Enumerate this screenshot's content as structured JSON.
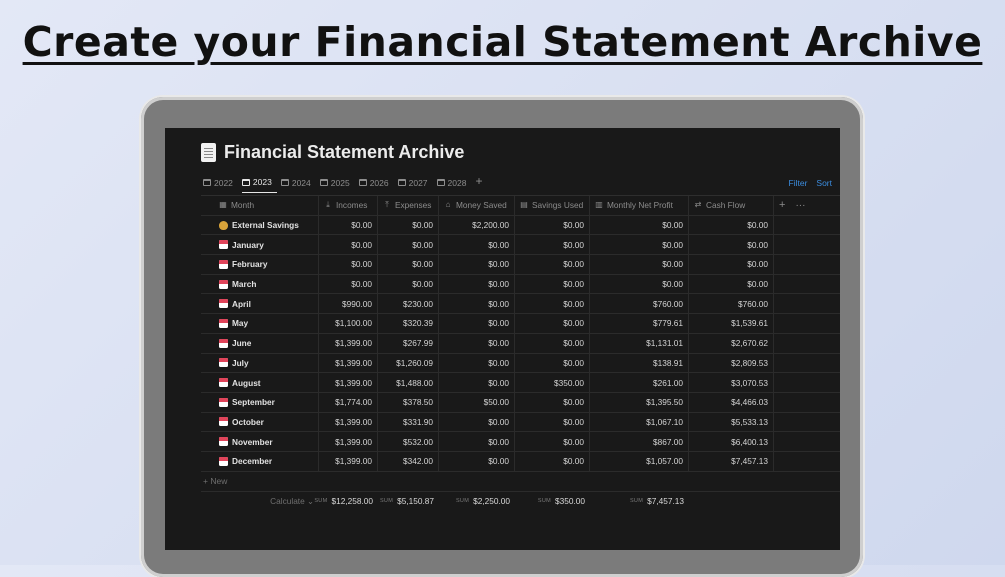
{
  "headline": "Create your Financial Statement Archive",
  "page": {
    "title": "Financial Statement Archive"
  },
  "tabs": [
    {
      "label": "2022",
      "active": false
    },
    {
      "label": "2023",
      "active": true
    },
    {
      "label": "2024",
      "active": false
    },
    {
      "label": "2025",
      "active": false
    },
    {
      "label": "2026",
      "active": false
    },
    {
      "label": "2027",
      "active": false
    },
    {
      "label": "2028",
      "active": false
    }
  ],
  "toolbar": {
    "filter": "Filter",
    "sort": "Sort"
  },
  "columns": [
    "Month",
    "Incomes",
    "Expenses",
    "Money Saved",
    "Savings Used",
    "Monthly Net Profit",
    "Cash Flow"
  ],
  "rows": [
    {
      "month": "External Savings",
      "icon": "money-bag-icon",
      "incomes": "$0.00",
      "expenses": "$0.00",
      "saved": "$2,200.00",
      "used": "$0.00",
      "net": "$0.00",
      "cash": "$0.00"
    },
    {
      "month": "January",
      "icon": "calendar-icon",
      "incomes": "$0.00",
      "expenses": "$0.00",
      "saved": "$0.00",
      "used": "$0.00",
      "net": "$0.00",
      "cash": "$0.00"
    },
    {
      "month": "February",
      "icon": "calendar-icon",
      "incomes": "$0.00",
      "expenses": "$0.00",
      "saved": "$0.00",
      "used": "$0.00",
      "net": "$0.00",
      "cash": "$0.00"
    },
    {
      "month": "March",
      "icon": "calendar-icon",
      "incomes": "$0.00",
      "expenses": "$0.00",
      "saved": "$0.00",
      "used": "$0.00",
      "net": "$0.00",
      "cash": "$0.00"
    },
    {
      "month": "April",
      "icon": "calendar-icon",
      "incomes": "$990.00",
      "expenses": "$230.00",
      "saved": "$0.00",
      "used": "$0.00",
      "net": "$760.00",
      "cash": "$760.00"
    },
    {
      "month": "May",
      "icon": "calendar-icon",
      "incomes": "$1,100.00",
      "expenses": "$320.39",
      "saved": "$0.00",
      "used": "$0.00",
      "net": "$779.61",
      "cash": "$1,539.61"
    },
    {
      "month": "June",
      "icon": "calendar-icon",
      "incomes": "$1,399.00",
      "expenses": "$267.99",
      "saved": "$0.00",
      "used": "$0.00",
      "net": "$1,131.01",
      "cash": "$2,670.62"
    },
    {
      "month": "July",
      "icon": "calendar-icon",
      "incomes": "$1,399.00",
      "expenses": "$1,260.09",
      "saved": "$0.00",
      "used": "$0.00",
      "net": "$138.91",
      "cash": "$2,809.53"
    },
    {
      "month": "August",
      "icon": "calendar-icon",
      "incomes": "$1,399.00",
      "expenses": "$1,488.00",
      "saved": "$0.00",
      "used": "$350.00",
      "net": "$261.00",
      "cash": "$3,070.53"
    },
    {
      "month": "September",
      "icon": "calendar-icon",
      "incomes": "$1,774.00",
      "expenses": "$378.50",
      "saved": "$50.00",
      "used": "$0.00",
      "net": "$1,395.50",
      "cash": "$4,466.03"
    },
    {
      "month": "October",
      "icon": "calendar-icon",
      "incomes": "$1,399.00",
      "expenses": "$331.90",
      "saved": "$0.00",
      "used": "$0.00",
      "net": "$1,067.10",
      "cash": "$5,533.13"
    },
    {
      "month": "November",
      "icon": "calendar-icon",
      "incomes": "$1,399.00",
      "expenses": "$532.00",
      "saved": "$0.00",
      "used": "$0.00",
      "net": "$867.00",
      "cash": "$6,400.13"
    },
    {
      "month": "December",
      "icon": "calendar-icon",
      "incomes": "$1,399.00",
      "expenses": "$342.00",
      "saved": "$0.00",
      "used": "$0.00",
      "net": "$1,057.00",
      "cash": "$7,457.13"
    }
  ],
  "new_row": "+ New",
  "footer": {
    "calculate": "Calculate ⌄",
    "sum_label": "SUM",
    "incomes": "$12,258.00",
    "expenses": "$5,150.87",
    "saved": "$2,250.00",
    "used": "$350.00",
    "net": "$7,457.13"
  },
  "colors": {
    "accent": "#3b8de0",
    "background": "#191919"
  }
}
